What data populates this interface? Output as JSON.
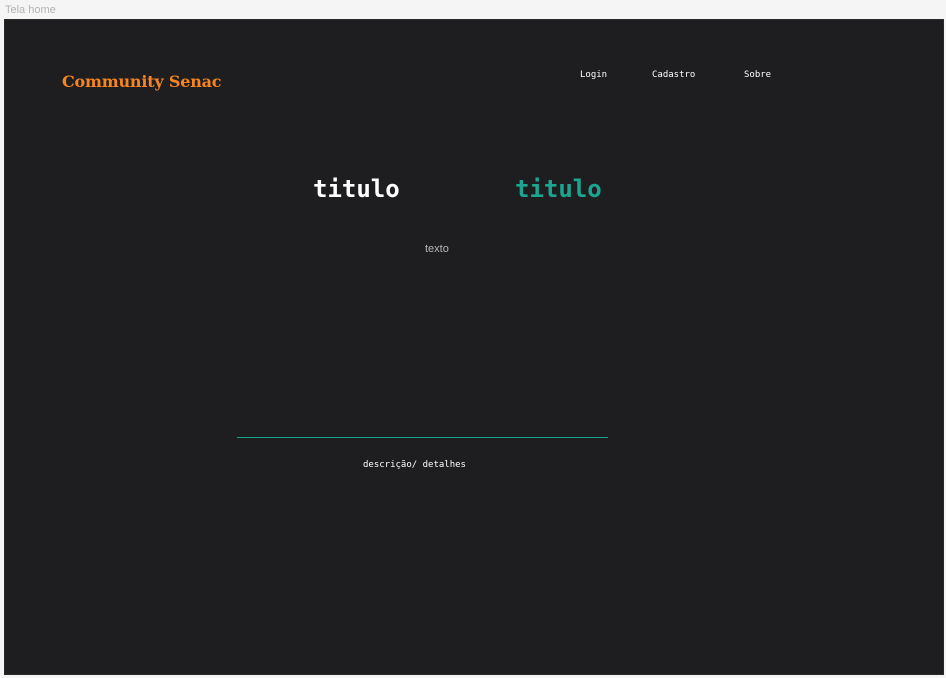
{
  "frame": {
    "label": "Tela home"
  },
  "header": {
    "logo": "Community Senac",
    "nav": [
      {
        "label": "Login"
      },
      {
        "label": "Cadastro"
      },
      {
        "label": "Sobre"
      }
    ]
  },
  "hero": {
    "title_left": "titulo",
    "title_right": "titulo",
    "text": "texto"
  },
  "footer": {
    "details": "descrição/ detalhes"
  },
  "colors": {
    "background": "#1e1e20",
    "logo": "#f7841f",
    "accent": "#1aa68f",
    "text": "#ffffff",
    "muted_text": "#b8b8b8"
  }
}
